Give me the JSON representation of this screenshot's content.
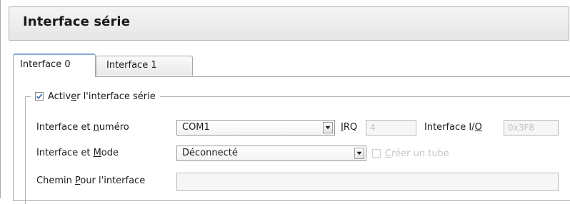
{
  "window": {
    "title": "Interface série"
  },
  "tabs": [
    {
      "label": "Interface 0",
      "active": true
    },
    {
      "label": "Interface 1",
      "active": false
    }
  ],
  "group": {
    "enable_checkbox": {
      "pre": "Activ",
      "mnemonic": "e",
      "post": "r l'interface série",
      "checked": true
    }
  },
  "rows": {
    "port_number": {
      "label_pre": "Interface et ",
      "label_mnemonic": "n",
      "label_post": "uméro",
      "value": "COM1"
    },
    "irq": {
      "label_pre": "",
      "label_mnemonic": "I",
      "label_post": "RQ",
      "value": "4"
    },
    "io": {
      "label_pre": "Interface I/",
      "label_mnemonic": "O",
      "label_post": "",
      "value": "0x3F8"
    },
    "port_mode": {
      "label_pre": "Interface et ",
      "label_mnemonic": "M",
      "label_post": "ode",
      "value": "Déconnecté"
    },
    "create_pipe": {
      "label_pre": "",
      "label_mnemonic": "C",
      "label_post": "réer un tube",
      "checked": false
    },
    "port_path": {
      "label_pre": "Chemin ",
      "label_mnemonic": "P",
      "label_post": "our l'interface",
      "value": ""
    }
  },
  "colors": {
    "active_tab_accent": "#86a8d4",
    "disabled_text": "#c6c6c6",
    "check_mark": "#3b6cb4"
  }
}
